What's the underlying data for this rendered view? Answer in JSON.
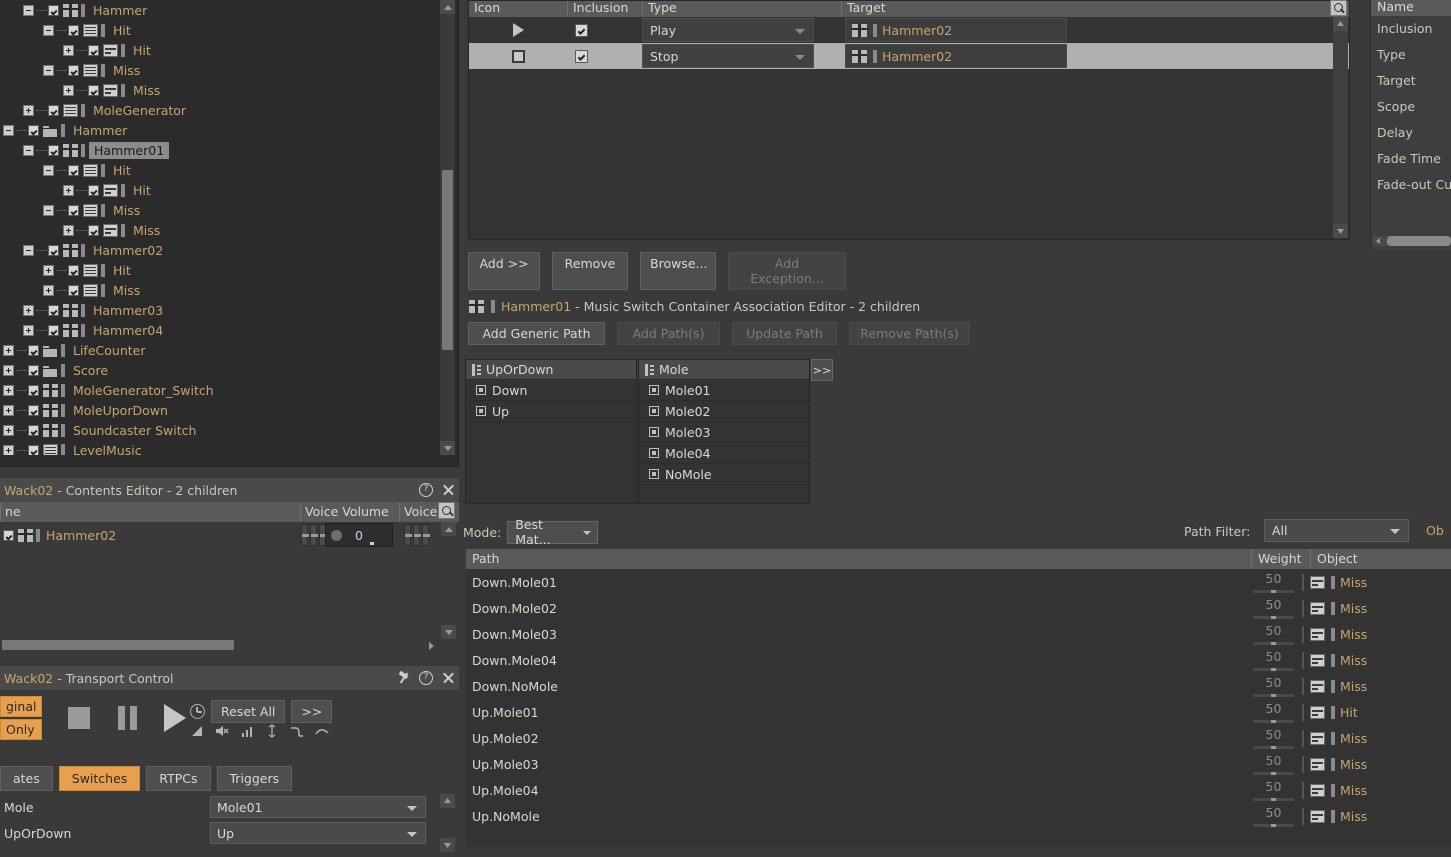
{
  "tree": {
    "items": [
      {
        "depth": 3,
        "exp": "minus",
        "icon": "music-switch-container",
        "label": "Hammer",
        "sel": false
      },
      {
        "depth": 4,
        "exp": "minus",
        "icon": "music-playlist",
        "label": "Hit",
        "sel": false
      },
      {
        "depth": 5,
        "exp": "plus",
        "icon": "music-segment",
        "label": "Hit",
        "sel": false
      },
      {
        "depth": 4,
        "exp": "minus",
        "icon": "music-playlist",
        "label": "Miss",
        "sel": false
      },
      {
        "depth": 5,
        "exp": "plus",
        "icon": "music-segment",
        "label": "Miss",
        "sel": false
      },
      {
        "depth": 3,
        "exp": "plus",
        "icon": "music-playlist",
        "label": "MoleGenerator",
        "sel": false
      },
      {
        "depth": 2,
        "exp": "minus",
        "icon": "folder",
        "label": "Hammer",
        "sel": false
      },
      {
        "depth": 3,
        "exp": "minus",
        "icon": "music-switch-container",
        "label": "Hammer01",
        "sel": true
      },
      {
        "depth": 4,
        "exp": "minus",
        "icon": "music-playlist",
        "label": "Hit",
        "sel": false
      },
      {
        "depth": 5,
        "exp": "plus",
        "icon": "music-segment",
        "label": "Hit",
        "sel": false
      },
      {
        "depth": 4,
        "exp": "minus",
        "icon": "music-playlist",
        "label": "Miss",
        "sel": false
      },
      {
        "depth": 5,
        "exp": "plus",
        "icon": "music-segment",
        "label": "Miss",
        "sel": false
      },
      {
        "depth": 3,
        "exp": "minus",
        "icon": "music-switch-container",
        "label": "Hammer02",
        "sel": false
      },
      {
        "depth": 4,
        "exp": "plus",
        "icon": "music-playlist",
        "label": "Hit",
        "sel": false
      },
      {
        "depth": 4,
        "exp": "plus",
        "icon": "music-playlist",
        "label": "Miss",
        "sel": false
      },
      {
        "depth": 3,
        "exp": "plus",
        "icon": "music-switch-container",
        "label": "Hammer03",
        "sel": false
      },
      {
        "depth": 3,
        "exp": "plus",
        "icon": "music-switch-container",
        "label": "Hammer04",
        "sel": false
      },
      {
        "depth": 2,
        "exp": "plus",
        "icon": "folder",
        "label": "LifeCounter",
        "sel": false
      },
      {
        "depth": 2,
        "exp": "plus",
        "icon": "folder",
        "label": "Score",
        "sel": false
      },
      {
        "depth": 2,
        "exp": "plus",
        "icon": "music-switch-container",
        "label": "MoleGenerator_Switch",
        "sel": false
      },
      {
        "depth": 2,
        "exp": "plus",
        "icon": "music-switch-container",
        "label": "MoleUporDown",
        "sel": false
      },
      {
        "depth": 2,
        "exp": "plus",
        "icon": "music-switch-container",
        "label": "Soundcaster Switch",
        "sel": false
      },
      {
        "depth": 2,
        "exp": "plus",
        "icon": "music-playlist",
        "label": "LevelMusic",
        "sel": false
      }
    ]
  },
  "event_table": {
    "columns": [
      "Icon",
      "Inclusion",
      "Type",
      "Target"
    ],
    "rows": [
      {
        "icon": "play-icon",
        "inclusion": true,
        "type": "Play",
        "target": "Hammer02",
        "selected": false
      },
      {
        "icon": "stop-icon",
        "inclusion": true,
        "type": "Stop",
        "target": "Hammer02",
        "selected": true
      }
    ]
  },
  "event_buttons": {
    "add": "Add >>",
    "remove": "Remove",
    "browse": "Browse...",
    "add_exception": "Add Exception..."
  },
  "column_list": {
    "header": "Name",
    "items": [
      "Inclusion",
      "Type",
      "Target",
      "Scope",
      "Delay",
      "Fade Time",
      "Fade-out Curv"
    ]
  },
  "association": {
    "title_obj": "Hammer01",
    "title_rest": " - Music Switch Container Association Editor - 2 children",
    "buttons": {
      "add_generic_path": "Add Generic Path",
      "add_paths": "Add Path(s)",
      "update_path": "Update Path",
      "remove_paths": "Remove Path(s)"
    },
    "groups": [
      {
        "name": "UpOrDown",
        "values": [
          "Down",
          "Up"
        ]
      },
      {
        "name": "Mole",
        "values": [
          "Mole01",
          "Mole02",
          "Mole03",
          "Mole04",
          "NoMole"
        ]
      }
    ],
    "transfer_button": ">>",
    "mode_label": "Mode:",
    "mode_value": "Best Mat...",
    "path_filter_label": "Path Filter:",
    "path_filter_value": "All",
    "object_label_cut": "Ob",
    "path_columns": [
      "Path",
      "Weight",
      "Object"
    ],
    "path_rows": [
      {
        "path": "Down.Mole01",
        "weight": "50",
        "object": "Miss"
      },
      {
        "path": "Down.Mole02",
        "weight": "50",
        "object": "Miss"
      },
      {
        "path": "Down.Mole03",
        "weight": "50",
        "object": "Miss"
      },
      {
        "path": "Down.Mole04",
        "weight": "50",
        "object": "Miss"
      },
      {
        "path": "Down.NoMole",
        "weight": "50",
        "object": "Miss"
      },
      {
        "path": "Up.Mole01",
        "weight": "50",
        "object": "Hit"
      },
      {
        "path": "Up.Mole02",
        "weight": "50",
        "object": "Miss"
      },
      {
        "path": "Up.Mole03",
        "weight": "50",
        "object": "Miss"
      },
      {
        "path": "Up.Mole04",
        "weight": "50",
        "object": "Miss"
      },
      {
        "path": "Up.NoMole",
        "weight": "50",
        "object": "Miss"
      }
    ]
  },
  "contents_editor": {
    "title_obj": "Wack02",
    "title_rest": " - Contents Editor - 2 children",
    "columns": [
      "ne",
      "Voice Volume",
      "Voice"
    ],
    "rows": [
      {
        "name": "Hammer02",
        "checked": true,
        "voice_volume": "0"
      }
    ]
  },
  "transport": {
    "title_obj": "Wack02",
    "title_rest": " - Transport Control",
    "original_buttons": [
      "ginal",
      "Only"
    ],
    "stop_label": "stop-icon",
    "pause_label": "pause-icon",
    "play_label": "play-icon",
    "reset_all": "Reset All",
    "more": ">>",
    "tabs": [
      {
        "label": "ates",
        "active": false
      },
      {
        "label": "Switches",
        "active": true
      },
      {
        "label": "RTPCs",
        "active": false
      },
      {
        "label": "Triggers",
        "active": false
      }
    ],
    "switches": [
      {
        "name": "Mole",
        "value": "Mole01"
      },
      {
        "name": "UpOrDown",
        "value": "Up"
      }
    ]
  }
}
